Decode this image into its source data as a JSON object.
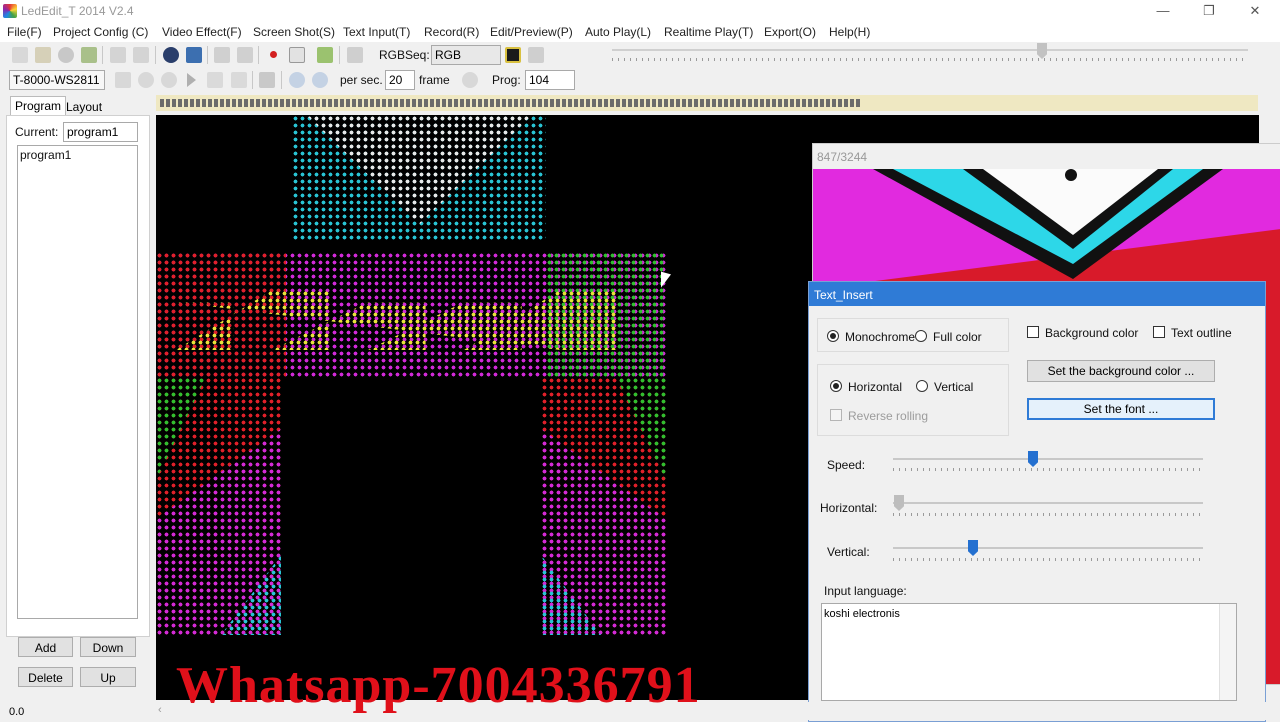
{
  "window": {
    "title": "LedEdit_T 2014 V2.4",
    "minimize": "—",
    "restore": "❐",
    "close": "✕"
  },
  "menu": [
    "File(F)",
    "Project Config (C)",
    "Video Effect(F)",
    "Screen Shot(S)",
    "Text Input(T)",
    "Record(R)",
    "Edit/Preview(P)",
    "Auto Play(L)",
    "Realtime Play(T)",
    "Export(O)",
    "Help(H)"
  ],
  "toolbar": {
    "rgbseq_label": "RGBSeq:",
    "rgbseq_value": "RGB",
    "controller": "T-8000-WS2811",
    "per_sec_label": "per sec.",
    "per_sec_value": "20",
    "frame_label": "frame",
    "prog_label": "Prog:",
    "prog_value": "104"
  },
  "left_panel": {
    "tabs": [
      "Program",
      "Layout"
    ],
    "current_label": "Current:",
    "current_value": "program1",
    "programs": [
      "program1"
    ],
    "buttons": {
      "add": "Add",
      "down": "Down",
      "delete": "Delete",
      "up": "Up"
    }
  },
  "preview": {
    "frame_counter": "847/3244"
  },
  "text_insert": {
    "title": "Text_Insert",
    "monochrome": "Monochrome",
    "full_color": "Full color",
    "background_color": "Background color",
    "text_outline": "Text outline",
    "horizontal": "Horizontal",
    "vertical": "Vertical",
    "reverse_rolling": "Reverse rolling",
    "set_bg_button": "Set the background color ...",
    "set_font_button": "Set the font ...",
    "speed_label": "Speed:",
    "horizontal_label": "Horizontal:",
    "vertical_label": "Vertical:",
    "input_language_label": "Input language:",
    "input_text": "koshi electronis"
  },
  "status": {
    "value": "0.0"
  },
  "watermark": "Whatsapp-7004336791",
  "colors": {
    "accent": "#2f7bd6",
    "led_red": "#e0202a",
    "led_magenta": "#d12ad8",
    "led_cyan": "#29c4d4",
    "led_green": "#2fbf2f",
    "led_yellow": "#e8e23a",
    "watermark": "#e0101a"
  }
}
